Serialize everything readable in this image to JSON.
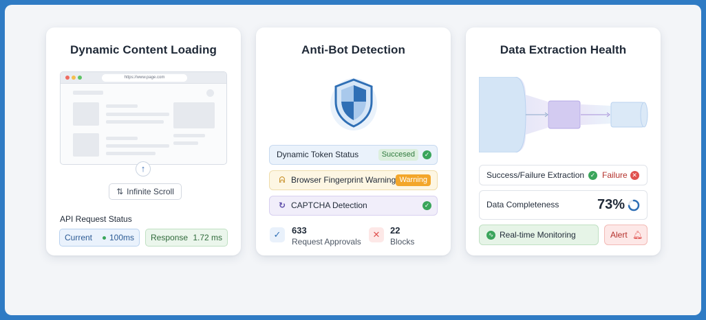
{
  "cards": [
    {
      "title": "Dynamic Content Loading",
      "browser": {
        "url": "https://www.page.com"
      },
      "infinite_scroll_label": "Infinite Scroll",
      "api_section_label": "API Request Status",
      "current": {
        "label": "Current",
        "value": "100ms"
      },
      "response": {
        "label": "Response",
        "value": "1.72 ms"
      }
    },
    {
      "title": "Anti-Bot Detection",
      "rows": [
        {
          "label": "Dynamic Token Status",
          "badge": "Succesed"
        },
        {
          "label": "Browser Fingerprint Warning",
          "badge": "Warning"
        },
        {
          "label": "CAPTCHA Detection"
        }
      ],
      "stats": [
        {
          "value": "633",
          "label": "Request Approvals"
        },
        {
          "value": "22",
          "label": "Blocks"
        }
      ]
    },
    {
      "title": "Data Extraction Health",
      "extraction": {
        "label": "Success/Failure Extraction",
        "failure": "Failure"
      },
      "completeness": {
        "label": "Data Completeness",
        "value": "73%",
        "fraction": 0.73
      },
      "monitoring_label": "Real-time Monitoring",
      "alert_label": "Alert"
    }
  ],
  "icons": {
    "shield": "shield-icon",
    "fingerprint": "fingerprint-icon",
    "refresh": "refresh-icon",
    "check": "check-icon",
    "x": "x-icon",
    "bell": "bell-icon",
    "pulse": "pulse-icon",
    "sort": "sort-icon",
    "arrow_up": "arrow-up-icon"
  },
  "colors": {
    "green": "#3aa55b",
    "blue": "#2f6fb5",
    "orange": "#f3a62a",
    "red": "#e0524f"
  }
}
